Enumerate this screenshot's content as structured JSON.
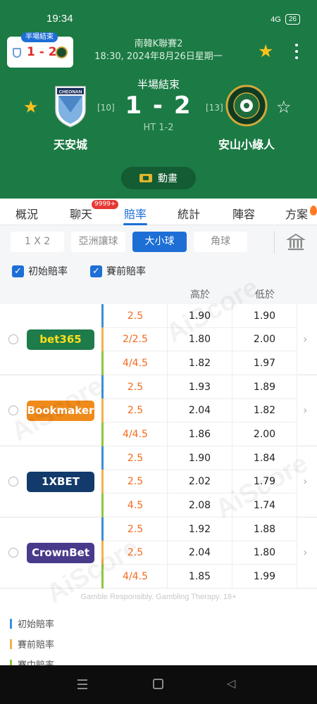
{
  "status_bar": {
    "time": "19:34",
    "signal": "4G",
    "battery": "26"
  },
  "header": {
    "mini_card": {
      "badge": "半場結束",
      "score": "1 - 2"
    },
    "league": "南韓K聯賽2",
    "datetime": "18:30, 2024年8月26日星期一",
    "match_status": "半場結束",
    "score": "1 - 2",
    "ht": "HT 1-2",
    "home": {
      "name": "天安城",
      "rank": "[10]",
      "logo_text": "CHEONAN"
    },
    "away": {
      "name": "安山小綠人",
      "rank": "[13]"
    },
    "animation_label": "動畫"
  },
  "tabs": [
    {
      "label": "概況",
      "active": false
    },
    {
      "label": "聊天",
      "active": false,
      "badge": "9999+"
    },
    {
      "label": "賠率",
      "active": true
    },
    {
      "label": "統計",
      "active": false
    },
    {
      "label": "陣容",
      "active": false
    },
    {
      "label": "方案",
      "active": false
    }
  ],
  "odds_types": [
    {
      "label": "1 X 2",
      "active": false
    },
    {
      "label": "亞洲讓球",
      "active": false
    },
    {
      "label": "大小球",
      "active": true
    },
    {
      "label": "角球",
      "active": false
    }
  ],
  "checkboxes": [
    {
      "label": "初始賠率",
      "checked": true
    },
    {
      "label": "賽前賠率",
      "checked": true
    }
  ],
  "table": {
    "headers": {
      "over": "高於",
      "under": "低於"
    },
    "line_colors": {
      "initial": "#3b8fd9",
      "prematch": "#f2b04b",
      "live": "#8dc63f"
    },
    "bookmakers": [
      {
        "name": "bet365",
        "color": "#1e7b4a",
        "text_color": "#ffdf1b",
        "rows": [
          {
            "line": "2.5",
            "over": "1.90",
            "under": "1.90"
          },
          {
            "line": "2/2.5",
            "over": "1.80",
            "under": "2.00"
          },
          {
            "line": "4/4.5",
            "over": "1.82",
            "under": "1.97"
          }
        ]
      },
      {
        "name": "Bookmaker",
        "color": "#f08a1a",
        "text_color": "#ffffff",
        "rows": [
          {
            "line": "2.5",
            "over": "1.93",
            "under": "1.89"
          },
          {
            "line": "2.5",
            "over": "2.04",
            "under": "1.82"
          },
          {
            "line": "4/4.5",
            "over": "1.86",
            "under": "2.00"
          }
        ]
      },
      {
        "name": "1XBET",
        "color": "#123a6b",
        "text_color": "#ffffff",
        "rows": [
          {
            "line": "2.5",
            "over": "1.90",
            "under": "1.84"
          },
          {
            "line": "2.5",
            "over": "2.02",
            "under": "1.79"
          },
          {
            "line": "4.5",
            "over": "2.08",
            "under": "1.74"
          }
        ]
      },
      {
        "name": "CrownBet",
        "color": "#4a3a8c",
        "text_color": "#ffffff",
        "rows": [
          {
            "line": "2.5",
            "over": "1.92",
            "under": "1.88"
          },
          {
            "line": "2.5",
            "over": "2.04",
            "under": "1.80"
          },
          {
            "line": "4/4.5",
            "over": "1.85",
            "under": "1.99"
          }
        ]
      }
    ]
  },
  "disclaimer": "Gamble Responsibly. Gambling Therapy. 18+",
  "legend": [
    {
      "label": "初始賠率",
      "color": "#3b8fd9"
    },
    {
      "label": "賽前賠率",
      "color": "#f2b04b"
    },
    {
      "label": "賽中賠率",
      "color": "#8dc63f"
    }
  ],
  "watermark": "AiScore"
}
